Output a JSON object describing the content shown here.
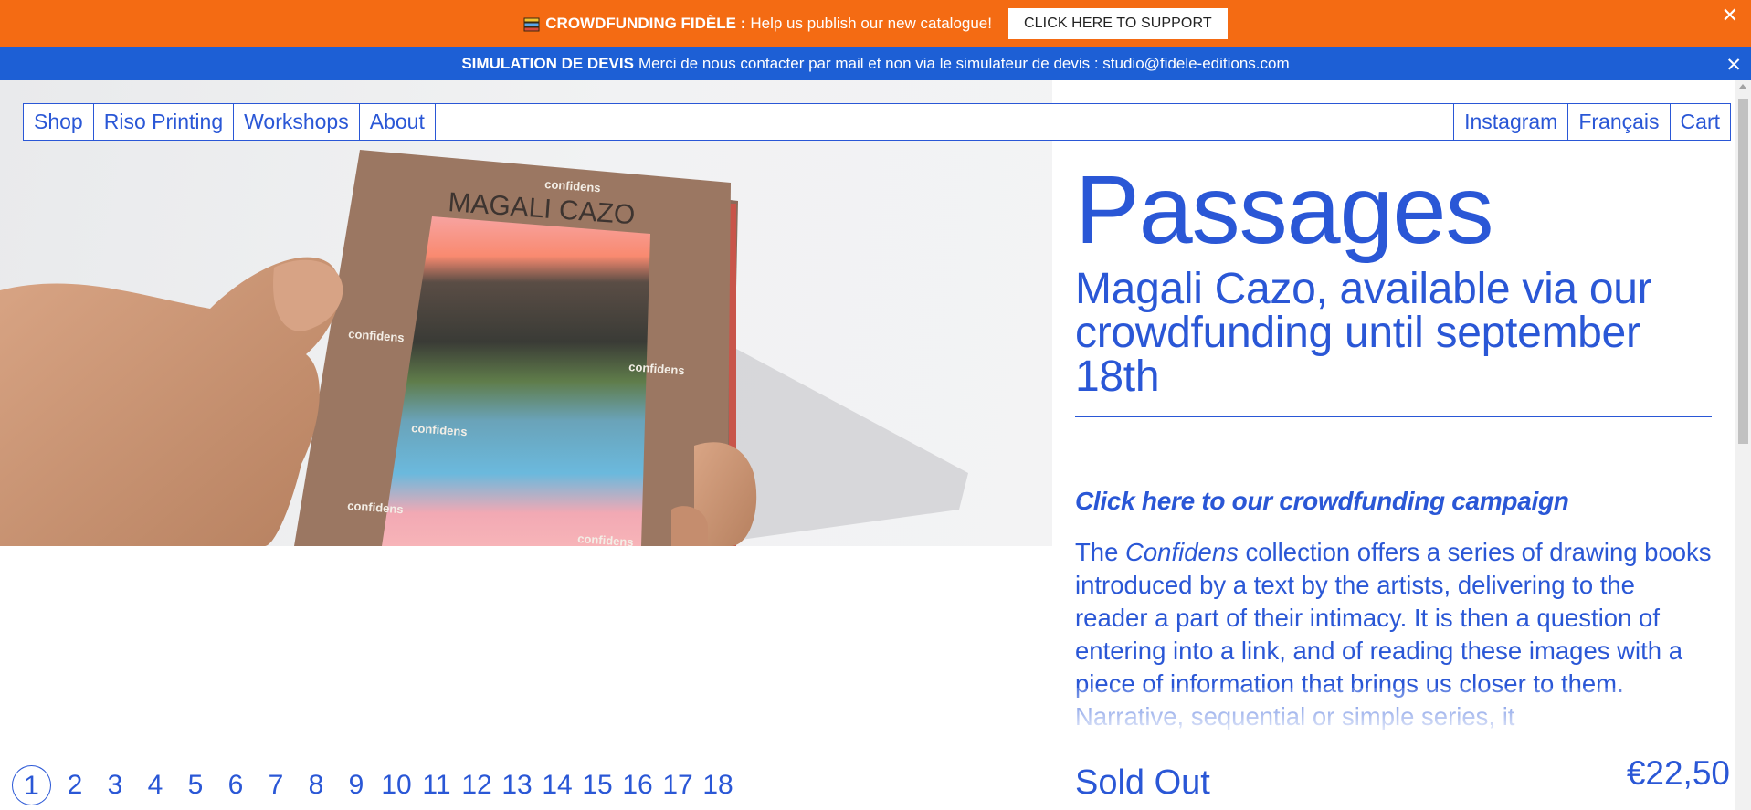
{
  "banner": {
    "title": "CROWDFUNDING FIDÈLE :",
    "message": "Help us publish our new catalogue!",
    "button": "CLICK HERE TO SUPPORT",
    "close": "✕"
  },
  "simulation_banner": {
    "title": "SIMULATION DE DEVIS",
    "message": "Merci de nous contacter par mail et non via le simulateur de devis : studio@fidele-editions.com",
    "close": "✕"
  },
  "nav": {
    "left": [
      "Shop",
      "Riso Printing",
      "Workshops",
      "About"
    ],
    "right": [
      "Instagram",
      "Français",
      "Cart"
    ]
  },
  "hero_image": {
    "book_author": "MAGALI CAZO",
    "book_label": "confidens"
  },
  "product": {
    "title": "Passages",
    "subtitle": "Magali Cazo, available via our crowdfunding until september 18th",
    "cta": "Click here to our crowdfunding campaign",
    "desc_prefix": "The ",
    "desc_italic": "Confidens",
    "desc_rest": " collection offers a series of drawing books introduced by a text by the artists, delivering to the reader a part of their intimacy. It is then a question of entering into a link, and of reading these images with a piece of information that brings us closer to them. Narrative, sequential or simple series, it",
    "status": "Sold Out",
    "price": "€22,50"
  },
  "pagination": {
    "pages": [
      "1",
      "2",
      "3",
      "4",
      "5",
      "6",
      "7",
      "8",
      "9",
      "10",
      "11",
      "12",
      "13",
      "14",
      "15",
      "16",
      "17",
      "18"
    ],
    "current": "1"
  },
  "colors": {
    "accent": "#2a57d6",
    "banner_orange": "#f46b13",
    "banner_blue": "#1d5fd5"
  }
}
